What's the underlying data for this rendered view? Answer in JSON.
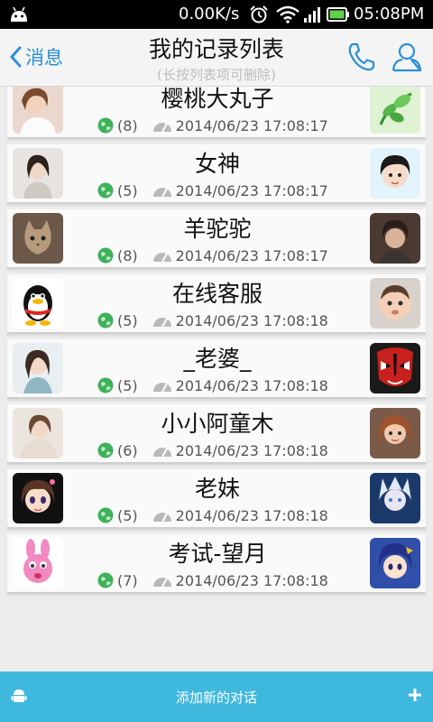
{
  "status_bar": {
    "speed": "0.00K/s",
    "time": "05:08PM",
    "battery_color": "#5fd34b"
  },
  "header": {
    "back_label": "消息",
    "title": "我的记录列表",
    "subtitle": "(长按列表项可删除)",
    "accent_color": "#2a8fd6",
    "icons": [
      "phone-icon",
      "person-icon"
    ]
  },
  "records": [
    {
      "name": "樱桃大丸子",
      "count": "(8)",
      "datetime": "2014/06/23 17:08:17"
    },
    {
      "name": "女神",
      "count": "(5)",
      "datetime": "2014/06/23 17:08:17"
    },
    {
      "name": "羊驼驼",
      "count": "(8)",
      "datetime": "2014/06/23 17:08:17"
    },
    {
      "name": "在线客服",
      "count": "(5)",
      "datetime": "2014/06/23 17:08:18"
    },
    {
      "name": "_老婆_",
      "count": "(5)",
      "datetime": "2014/06/23 17:08:18"
    },
    {
      "name": "小小阿童木",
      "count": "(6)",
      "datetime": "2014/06/23 17:08:18"
    },
    {
      "name": "老妹",
      "count": "(5)",
      "datetime": "2014/06/23 17:08:18"
    },
    {
      "name": "考试-望月",
      "count": "(7)",
      "datetime": "2014/06/23 17:08:18"
    }
  ],
  "footer": {
    "add_label": "添加新的对话",
    "bar_color": "#3fb8de"
  }
}
